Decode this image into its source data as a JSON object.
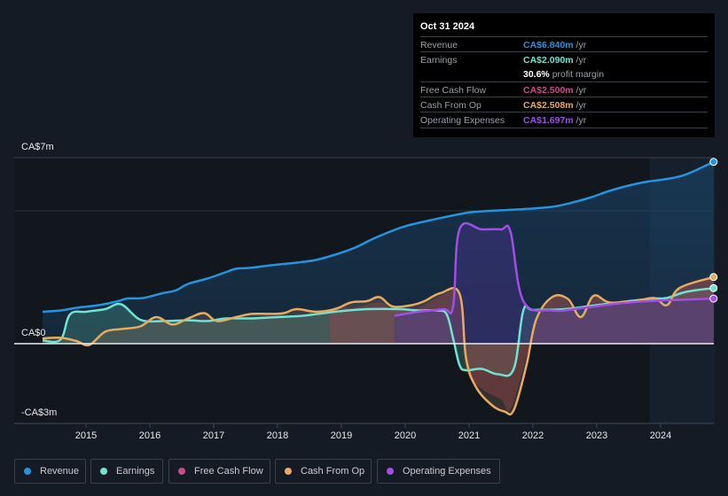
{
  "tooltip": {
    "date": "Oct 31 2024",
    "rows": [
      {
        "label": "Revenue",
        "value": "CA$6.840m",
        "unit": "/yr",
        "color": "#2394df"
      },
      {
        "label": "Earnings",
        "value": "CA$2.090m",
        "unit": "/yr",
        "color": "#6fe3d1"
      },
      {
        "label": "",
        "value": "30.6%",
        "unit": "profit margin",
        "color": "#ffffff"
      },
      {
        "label": "Free Cash Flow",
        "value": "CA$2.500m",
        "unit": "/yr",
        "color": "#c84b8c"
      },
      {
        "label": "Cash From Op",
        "value": "CA$2.508m",
        "unit": "/yr",
        "color": "#e8aa5f"
      },
      {
        "label": "Operating Expenses",
        "value": "CA$1.697m",
        "unit": "/yr",
        "color": "#a24de8"
      }
    ]
  },
  "legend": [
    {
      "label": "Revenue",
      "color": "#2394df"
    },
    {
      "label": "Earnings",
      "color": "#6fe3d1"
    },
    {
      "label": "Free Cash Flow",
      "color": "#c84b8c"
    },
    {
      "label": "Cash From Op",
      "color": "#e8aa5f"
    },
    {
      "label": "Operating Expenses",
      "color": "#a24de8"
    }
  ],
  "chart_data": {
    "type": "line",
    "title": "",
    "xlabel": "",
    "ylabel": "",
    "y_tick_labels": [
      "CA$7m",
      "CA$0",
      "-CA$3m"
    ],
    "ylim": [
      -3,
      7
    ],
    "xlim": [
      2014.3,
      2024.85
    ],
    "x_ticks": [
      2015,
      2016,
      2017,
      2018,
      2019,
      2020,
      2021,
      2022,
      2023,
      2024
    ],
    "x_tick_labels": [
      "2015",
      "2016",
      "2017",
      "2018",
      "2019",
      "2020",
      "2021",
      "2022",
      "2023",
      "2024"
    ],
    "highlight_region_start": 2023.83,
    "legend_position": "bottom",
    "series": [
      {
        "name": "Revenue",
        "color": "#2394df",
        "points": [
          [
            2014.32,
            1.2
          ],
          [
            2014.6,
            1.25
          ],
          [
            2014.85,
            1.35
          ],
          [
            2015.2,
            1.45
          ],
          [
            2015.5,
            1.6
          ],
          [
            2015.65,
            1.7
          ],
          [
            2015.9,
            1.72
          ],
          [
            2016.2,
            1.9
          ],
          [
            2016.4,
            2.0
          ],
          [
            2016.6,
            2.25
          ],
          [
            2016.9,
            2.45
          ],
          [
            2017.2,
            2.7
          ],
          [
            2017.35,
            2.82
          ],
          [
            2017.55,
            2.85
          ],
          [
            2017.9,
            2.95
          ],
          [
            2018.3,
            3.05
          ],
          [
            2018.6,
            3.15
          ],
          [
            2018.9,
            3.35
          ],
          [
            2019.2,
            3.6
          ],
          [
            2019.5,
            3.95
          ],
          [
            2019.8,
            4.25
          ],
          [
            2020.0,
            4.42
          ],
          [
            2020.4,
            4.65
          ],
          [
            2020.8,
            4.85
          ],
          [
            2021.05,
            4.95
          ],
          [
            2021.5,
            5.02
          ],
          [
            2021.9,
            5.07
          ],
          [
            2022.3,
            5.15
          ],
          [
            2022.6,
            5.3
          ],
          [
            2022.9,
            5.5
          ],
          [
            2023.2,
            5.75
          ],
          [
            2023.5,
            5.95
          ],
          [
            2023.8,
            6.1
          ],
          [
            2024.1,
            6.2
          ],
          [
            2024.4,
            6.37
          ],
          [
            2024.83,
            6.84
          ]
        ]
      },
      {
        "name": "Earnings",
        "color": "#6fe3d1",
        "points": [
          [
            2014.32,
            0.12
          ],
          [
            2014.6,
            0.15
          ],
          [
            2014.75,
            1.1
          ],
          [
            2015.0,
            1.2
          ],
          [
            2015.3,
            1.3
          ],
          [
            2015.55,
            1.48
          ],
          [
            2015.85,
            0.9
          ],
          [
            2016.2,
            0.85
          ],
          [
            2016.6,
            0.88
          ],
          [
            2016.9,
            0.85
          ],
          [
            2017.2,
            0.95
          ],
          [
            2017.6,
            0.95
          ],
          [
            2018.0,
            1.0
          ],
          [
            2018.4,
            1.05
          ],
          [
            2018.9,
            1.2
          ],
          [
            2019.4,
            1.3
          ],
          [
            2019.9,
            1.3
          ],
          [
            2020.2,
            1.25
          ],
          [
            2020.5,
            1.25
          ],
          [
            2020.65,
            1.1
          ],
          [
            2020.75,
            0.2
          ],
          [
            2020.85,
            -0.8
          ],
          [
            2020.95,
            -1.0
          ],
          [
            2021.2,
            -0.95
          ],
          [
            2021.45,
            -1.15
          ],
          [
            2021.7,
            -0.95
          ],
          [
            2021.85,
            1.25
          ],
          [
            2022.0,
            1.27
          ],
          [
            2022.5,
            1.3
          ],
          [
            2023.0,
            1.45
          ],
          [
            2023.5,
            1.6
          ],
          [
            2023.9,
            1.7
          ],
          [
            2024.1,
            1.72
          ],
          [
            2024.4,
            1.95
          ],
          [
            2024.83,
            2.09
          ]
        ]
      },
      {
        "name": "Free Cash Flow",
        "color": "#c84b8c",
        "fill_only": true,
        "points": [
          [
            2018.83,
            0.0
          ],
          [
            2018.85,
            1.3
          ],
          [
            2019.2,
            1.35
          ],
          [
            2019.6,
            1.55
          ],
          [
            2019.8,
            1.3
          ],
          [
            2020.2,
            1.35
          ],
          [
            2020.6,
            1.85
          ],
          [
            2020.85,
            1.85
          ],
          [
            2020.95,
            -0.9
          ],
          [
            2021.2,
            -1.7
          ],
          [
            2021.5,
            -2.1
          ],
          [
            2021.65,
            -2.45
          ],
          [
            2021.9,
            -0.5
          ],
          [
            2022.1,
            1.2
          ],
          [
            2022.3,
            1.75
          ],
          [
            2022.5,
            1.7
          ],
          [
            2022.75,
            1.0
          ],
          [
            2022.95,
            1.75
          ],
          [
            2023.2,
            1.55
          ],
          [
            2023.6,
            1.6
          ],
          [
            2023.9,
            1.75
          ],
          [
            2024.1,
            1.5
          ],
          [
            2024.3,
            2.1
          ],
          [
            2024.83,
            2.5
          ]
        ]
      },
      {
        "name": "Cash From Op",
        "color": "#e8aa5f",
        "points": [
          [
            2014.32,
            0.2
          ],
          [
            2014.6,
            0.22
          ],
          [
            2014.85,
            0.1
          ],
          [
            2015.05,
            -0.05
          ],
          [
            2015.3,
            0.45
          ],
          [
            2015.55,
            0.55
          ],
          [
            2015.85,
            0.65
          ],
          [
            2016.1,
            1.0
          ],
          [
            2016.35,
            0.72
          ],
          [
            2016.6,
            0.95
          ],
          [
            2016.85,
            1.15
          ],
          [
            2017.05,
            0.85
          ],
          [
            2017.35,
            1.0
          ],
          [
            2017.6,
            1.12
          ],
          [
            2017.9,
            1.12
          ],
          [
            2018.1,
            1.15
          ],
          [
            2018.3,
            1.3
          ],
          [
            2018.6,
            1.2
          ],
          [
            2018.9,
            1.3
          ],
          [
            2019.15,
            1.55
          ],
          [
            2019.4,
            1.6
          ],
          [
            2019.6,
            1.75
          ],
          [
            2019.8,
            1.4
          ],
          [
            2020.1,
            1.45
          ],
          [
            2020.3,
            1.6
          ],
          [
            2020.55,
            1.9
          ],
          [
            2020.85,
            1.88
          ],
          [
            2020.95,
            -0.5
          ],
          [
            2021.1,
            -1.6
          ],
          [
            2021.35,
            -2.3
          ],
          [
            2021.55,
            -2.55
          ],
          [
            2021.7,
            -2.5
          ],
          [
            2021.9,
            -0.8
          ],
          [
            2022.05,
            0.9
          ],
          [
            2022.3,
            1.75
          ],
          [
            2022.55,
            1.68
          ],
          [
            2022.75,
            1.0
          ],
          [
            2022.95,
            1.8
          ],
          [
            2023.2,
            1.55
          ],
          [
            2023.6,
            1.6
          ],
          [
            2023.9,
            1.72
          ],
          [
            2024.1,
            1.45
          ],
          [
            2024.3,
            2.1
          ],
          [
            2024.83,
            2.508
          ]
        ]
      },
      {
        "name": "Operating Expenses",
        "color": "#a24de8",
        "points": [
          [
            2019.83,
            1.05
          ],
          [
            2020.2,
            1.2
          ],
          [
            2020.6,
            1.3
          ],
          [
            2020.75,
            1.4
          ],
          [
            2020.85,
            4.3
          ],
          [
            2021.2,
            4.3
          ],
          [
            2021.5,
            4.3
          ],
          [
            2021.65,
            4.2
          ],
          [
            2021.85,
            1.6
          ],
          [
            2022.3,
            1.25
          ],
          [
            2022.8,
            1.35
          ],
          [
            2023.3,
            1.5
          ],
          [
            2023.8,
            1.6
          ],
          [
            2024.3,
            1.65
          ],
          [
            2024.83,
            1.697
          ]
        ]
      }
    ]
  }
}
